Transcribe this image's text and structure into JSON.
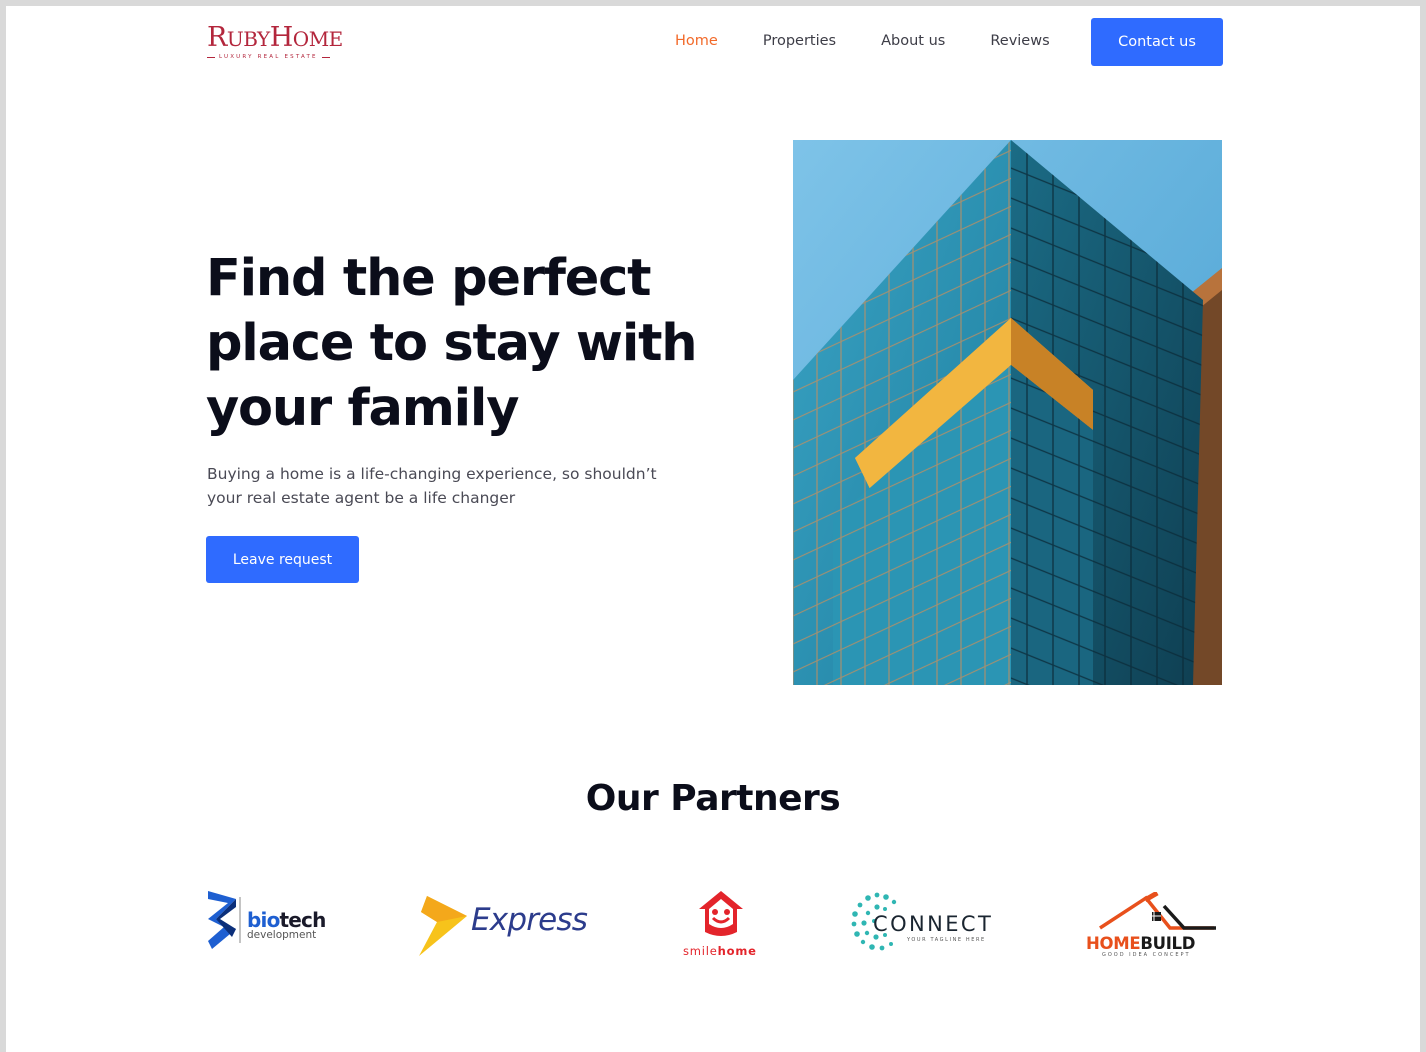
{
  "brand": {
    "name_first": "R",
    "name_mid": "UBY",
    "name_second": "H",
    "name_end": "OME",
    "tagline": "LUXURY REAL ESTATE"
  },
  "nav": {
    "items": [
      {
        "label": "Home",
        "active": true
      },
      {
        "label": "Properties",
        "active": false
      },
      {
        "label": "About us",
        "active": false
      },
      {
        "label": "Reviews",
        "active": false
      }
    ],
    "contact_label": "Contact us"
  },
  "hero": {
    "title_line1": "Find the perfect",
    "title_line2": "place to stay with",
    "title_line3": "your family",
    "subtitle_line1": "Buying a home is a life-changing experience, so shouldn’t",
    "subtitle_line2": "your real estate agent be a life changer",
    "cta_label": "Leave request"
  },
  "partners": {
    "title": "Our Partners",
    "logos": [
      {
        "name": "biotech",
        "text_a": "bio",
        "text_b": "tech",
        "sub": "development"
      },
      {
        "name": "express",
        "text": "Express"
      },
      {
        "name": "smilehome",
        "text_a": "smile",
        "text_b": "home"
      },
      {
        "name": "connect",
        "text": "CONNECT",
        "sub": "YOUR TAGLINE HERE"
      },
      {
        "name": "homebuild",
        "text_a": "HOME",
        "text_b": "BUILD",
        "sub": "GOOD IDEA CONCEPT"
      }
    ]
  },
  "colors": {
    "accent": "#2f6bff",
    "brand": "#b3263c",
    "nav_active": "#f26a2a",
    "heading": "#0b0d1a"
  }
}
